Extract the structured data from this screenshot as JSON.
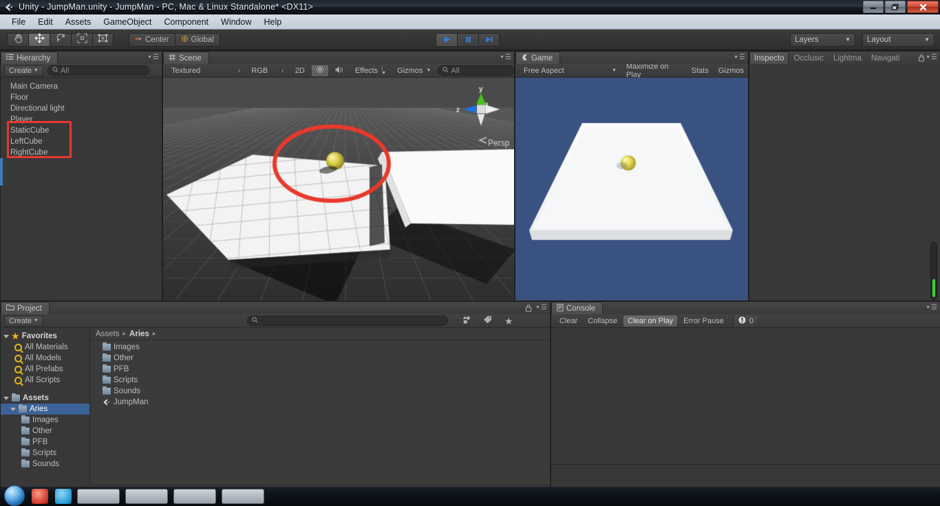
{
  "window": {
    "title": "Unity - JumpMan.unity - JumpMan - PC, Mac & Linux Standalone* <DX11>",
    "app_icon": "unity-icon",
    "minimize_label": "–",
    "restore_label": "❐",
    "close_label": "✕"
  },
  "menubar": {
    "items": [
      {
        "label": "File"
      },
      {
        "label": "Edit"
      },
      {
        "label": "Assets"
      },
      {
        "label": "GameObject"
      },
      {
        "label": "Component"
      },
      {
        "label": "Window"
      },
      {
        "label": "Help"
      }
    ]
  },
  "toolbar": {
    "transform_tools": [
      {
        "name": "hand-tool",
        "icon": "hand-icon",
        "active": false
      },
      {
        "name": "move-tool",
        "icon": "move-arrows-icon",
        "active": true
      },
      {
        "name": "rotate-tool",
        "icon": "rotate-icon",
        "active": false
      },
      {
        "name": "scale-tool",
        "icon": "scale-icon",
        "active": false
      },
      {
        "name": "rect-tool",
        "icon": "rect-transform-icon",
        "active": false
      }
    ],
    "pivot_label": "Center",
    "pivot_icon": "pivot-center-icon",
    "space_label": "Global",
    "space_icon": "global-space-icon",
    "play_label": "▶",
    "pause_label": "‖",
    "step_label": "▶|",
    "layers_label": "Layers",
    "layout_label": "Layout"
  },
  "hierarchy": {
    "tab_label": "Hierarchy",
    "tab_icon": "hierarchy-icon",
    "create_label": "Create",
    "search_placeholder": "All",
    "search_icon": "search-icon",
    "items": [
      {
        "label": "Main Camera",
        "highlighted": false
      },
      {
        "label": "Floor",
        "highlighted": false
      },
      {
        "label": "Directional light",
        "highlighted": false
      },
      {
        "label": "Player",
        "highlighted": false
      },
      {
        "label": "StaticCube",
        "highlighted": true
      },
      {
        "label": "LeftCube",
        "highlighted": true
      },
      {
        "label": "RightCube",
        "highlighted": true
      }
    ],
    "annotation_color": "#e8392c"
  },
  "scene": {
    "tab_label": "Scene",
    "tab_icon": "scene-icon",
    "draw_mode": "Textured",
    "color_mode": "RGB",
    "two_d_label": "2D",
    "lighting_icon": "sun-icon",
    "audio_icon": "speaker-icon",
    "effects_label": "Effects",
    "gizmos_label": "Gizmos",
    "search_placeholder": "All",
    "perspective_label": "Persp",
    "axis_y_label": "y",
    "axis_z_label": "z",
    "annotation_color": "#e8392c",
    "background_color": "#4a4a4a",
    "floor_color": "#f2f2f2",
    "sphere_color": "#d8cf48"
  },
  "game": {
    "tab_label": "Game",
    "tab_icon": "game-icon",
    "aspect_label": "Free Aspect",
    "maximize_label": "Maximize on Play",
    "stats_label": "Stats",
    "gizmos_label": "Gizmos",
    "background_color": "#3a5280",
    "platform_color": "#f4f4f4",
    "sphere_color": "#e2d64e"
  },
  "inspector": {
    "tabs": [
      {
        "label": "Inspecto",
        "active": true
      },
      {
        "label": "Occlusic",
        "active": false
      },
      {
        "label": "Lightma",
        "active": false
      },
      {
        "label": "Navigati",
        "active": false
      }
    ],
    "lock_icon": "lock-icon",
    "menu_icon": "panel-menu-icon"
  },
  "project": {
    "tab_label": "Project",
    "tab_icon": "project-icon",
    "create_label": "Create",
    "search_placeholder": "",
    "search_icon": "search-icon",
    "filter_type_icon": "filter-by-type-icon",
    "filter_label_icon": "filter-by-label-icon",
    "favorite_icon": "star-icon",
    "tree": [
      {
        "label": "Favorites",
        "depth": 0,
        "kind": "star",
        "expanded": true,
        "selected": false
      },
      {
        "label": "All Materials",
        "depth": 1,
        "kind": "search",
        "selected": false
      },
      {
        "label": "All Models",
        "depth": 1,
        "kind": "search",
        "selected": false
      },
      {
        "label": "All Prefabs",
        "depth": 1,
        "kind": "search",
        "selected": false
      },
      {
        "label": "All Scripts",
        "depth": 1,
        "kind": "search",
        "selected": false
      },
      {
        "label": "Assets",
        "depth": 0,
        "kind": "folder",
        "expanded": true,
        "selected": false
      },
      {
        "label": "Aries",
        "depth": 1,
        "kind": "folder",
        "expanded": true,
        "selected": true
      },
      {
        "label": "Images",
        "depth": 2,
        "kind": "folder",
        "selected": false
      },
      {
        "label": "Other",
        "depth": 2,
        "kind": "folder",
        "selected": false
      },
      {
        "label": "PFB",
        "depth": 2,
        "kind": "folder",
        "selected": false
      },
      {
        "label": "Scripts",
        "depth": 2,
        "kind": "folder",
        "selected": false
      },
      {
        "label": "Sounds",
        "depth": 2,
        "kind": "folder",
        "selected": false
      }
    ],
    "breadcrumb": [
      {
        "label": "Assets",
        "current": false
      },
      {
        "label": "Aries",
        "current": true
      }
    ],
    "breadcrumb_sep": "▸",
    "contents": [
      {
        "label": "Images",
        "kind": "folder"
      },
      {
        "label": "Other",
        "kind": "folder"
      },
      {
        "label": "PFB",
        "kind": "folder"
      },
      {
        "label": "Scripts",
        "kind": "folder"
      },
      {
        "label": "Sounds",
        "kind": "folder"
      },
      {
        "label": "JumpMan",
        "kind": "scene"
      }
    ]
  },
  "console": {
    "tab_label": "Console",
    "tab_icon": "console-icon",
    "clear_label": "Clear",
    "collapse_label": "Collapse",
    "clear_on_play_label": "Clear on Play",
    "error_pause_label": "Error Pause",
    "error_count": "0",
    "error_icon": "error-icon",
    "messages": []
  },
  "taskbar": {
    "start_icon": "windows-start-orb",
    "pinned": [
      "media-icon",
      "browser-icon"
    ],
    "windows": [
      "window-1",
      "window-2",
      "window-3",
      "window-4"
    ]
  }
}
